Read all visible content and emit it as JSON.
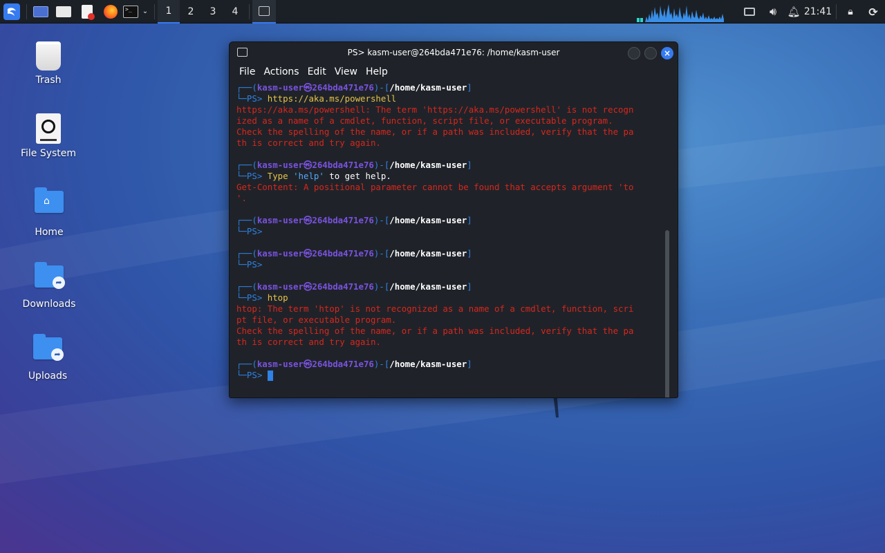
{
  "panel": {
    "workspaces": [
      "1",
      "2",
      "3",
      "4"
    ],
    "clock": "21:41"
  },
  "desktop": {
    "icons": [
      {
        "label": "Trash"
      },
      {
        "label": "File System"
      },
      {
        "label": "Home"
      },
      {
        "label": "Downloads"
      },
      {
        "label": "Uploads"
      }
    ]
  },
  "terminal": {
    "title": "PS> kasm-user@264bda471e76: /home/kasm-user",
    "menu": [
      "File",
      "Actions",
      "Edit",
      "View",
      "Help"
    ],
    "prompt": {
      "frame_top": "┌──(",
      "frame_bottom": "└─",
      "user": "kasm-user",
      "at": "㉿",
      "host": "264bda471e76",
      "mid": ")-[",
      "path": "/home/kasm-user",
      "close": "]",
      "ps": "PS> "
    },
    "blocks": [
      {
        "cmd": "https://aka.ms/powershell",
        "cmd_rest": "",
        "errors": [
          "https://aka.ms/powershell: The term 'https://aka.ms/powershell' is not recogn",
          "ized as a name of a cmdlet, function, script file, or executable program.",
          "Check the spelling of the name, or if a path was included, verify that the pa",
          "th is correct and try again."
        ]
      },
      {
        "cmd": "Type",
        "cmd_str": "'help'",
        "cmd_rest": " to get help.",
        "errors": [
          "Get-Content: A positional parameter cannot be found that accepts argument 'to",
          "'."
        ]
      },
      {
        "cmd": "",
        "cmd_rest": "",
        "errors": []
      },
      {
        "cmd": "",
        "cmd_rest": "",
        "errors": []
      },
      {
        "cmd": "htop",
        "cmd_rest": "",
        "errors": [
          "htop: The term 'htop' is not recognized as a name of a cmdlet, function, scri",
          "pt file, or executable program.",
          "Check the spelling of the name, or if a path was included, verify that the pa",
          "th is correct and try again."
        ]
      },
      {
        "cmd": "",
        "cmd_rest": "",
        "errors": [],
        "cursor": true
      }
    ]
  },
  "colors": {
    "accent": "#367bf0",
    "prompt_frame": "#2f82e6",
    "prompt_user": "#6b4fd8",
    "error": "#d9261c",
    "command": "#e8c34a"
  }
}
